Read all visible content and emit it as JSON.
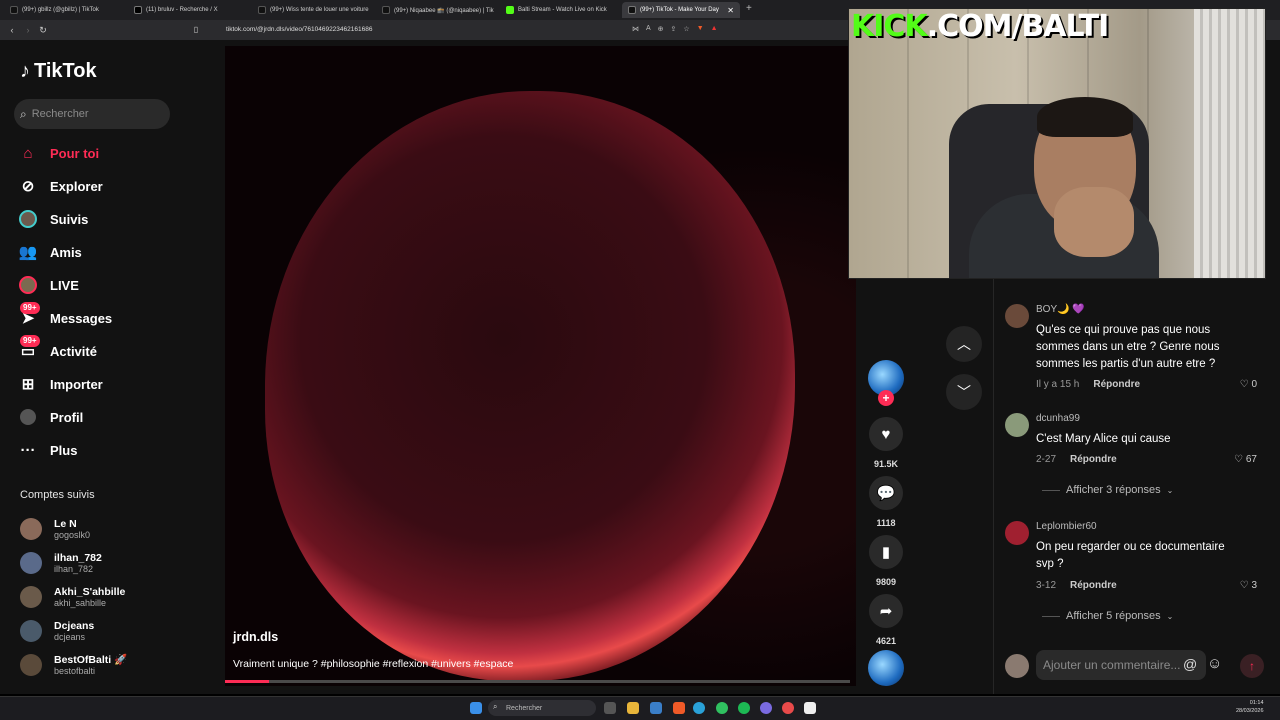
{
  "browser": {
    "tabs": [
      {
        "label": "(99+) gbillz (@gbillz) | TikTok",
        "color": "#222"
      },
      {
        "label": "(11) bruluv - Recherche / X",
        "color": "#444"
      },
      {
        "label": "(99+) Wiss tente de louer une voiture",
        "color": "#222"
      },
      {
        "label": "(99+) Niqaabee 🕋 (@niqaabee) | Tik",
        "color": "#222"
      },
      {
        "label": "Balti Stream - Watch Live on Kick",
        "color": "#53fc18"
      },
      {
        "label": "(99+) TikTok - Make Your Day",
        "color": "#222"
      }
    ],
    "url": "tiktok.com/@jrdn.dls/video/7610469223462161686"
  },
  "sidebar": {
    "logo": "TikTok",
    "search_placeholder": "Rechercher",
    "nav": [
      {
        "label": "Pour toi",
        "icon": "home-icon"
      },
      {
        "label": "Explorer",
        "icon": "compass-icon"
      },
      {
        "label": "Suivis",
        "icon": "following-avatar-icon"
      },
      {
        "label": "Amis",
        "icon": "friends-icon"
      },
      {
        "label": "LIVE",
        "icon": "live-icon"
      },
      {
        "label": "Messages",
        "icon": "messages-icon",
        "badge": "99+"
      },
      {
        "label": "Activité",
        "icon": "activity-icon",
        "badge": "99+"
      },
      {
        "label": "Importer",
        "icon": "upload-icon"
      },
      {
        "label": "Profil",
        "icon": "profile-icon"
      },
      {
        "label": "Plus",
        "icon": "more-icon"
      }
    ],
    "followed_title": "Comptes suivis",
    "followed": [
      {
        "name": "Le N",
        "handle": "gogoslk0"
      },
      {
        "name": "ilhan_782",
        "handle": "ilhan_782"
      },
      {
        "name": "Akhi_S'ahbille",
        "handle": "akhi_sahbille"
      },
      {
        "name": "Dcjeans",
        "handle": "dcjeans"
      },
      {
        "name": "BestOfBalti 🚀",
        "handle": "bestofbalti"
      }
    ]
  },
  "video": {
    "author": "jrdn.dls",
    "caption": "Vraiment unique ? #philosophie #reflexion #univers #espace",
    "progress": 0.07
  },
  "actions": {
    "likes": "91.5K",
    "comments": "1118",
    "saves": "9809",
    "shares": "4621"
  },
  "comments": [
    {
      "user": "BOY🌙 💜",
      "text": "Qu'es ce qui prouve pas que nous sommes dans un etre ? Genre nous sommes les partis d'un autre etre ?",
      "time": "Il y a 15 h",
      "reply": "Répondre",
      "likes": "0"
    },
    {
      "user": "dcunha99",
      "text": "C'est Mary Alice qui cause",
      "time": "2-27",
      "reply": "Répondre",
      "likes": "67"
    },
    {
      "user": "Leplombier60",
      "text": "On peu regarder ou ce documentaire svp ?",
      "time": "3-12",
      "reply": "Répondre",
      "likes": "3"
    }
  ],
  "replies_more": [
    "Afficher 3 réponses",
    "Afficher 5 réponses"
  ],
  "comment_input_placeholder": "Ajouter un commentaire...",
  "overlay": {
    "brand_kick": "KICK",
    "brand_rest": ".COM/BALTI"
  },
  "taskbar": {
    "search": "Rechercher",
    "time": "01:14",
    "date": "28/03/2026"
  }
}
